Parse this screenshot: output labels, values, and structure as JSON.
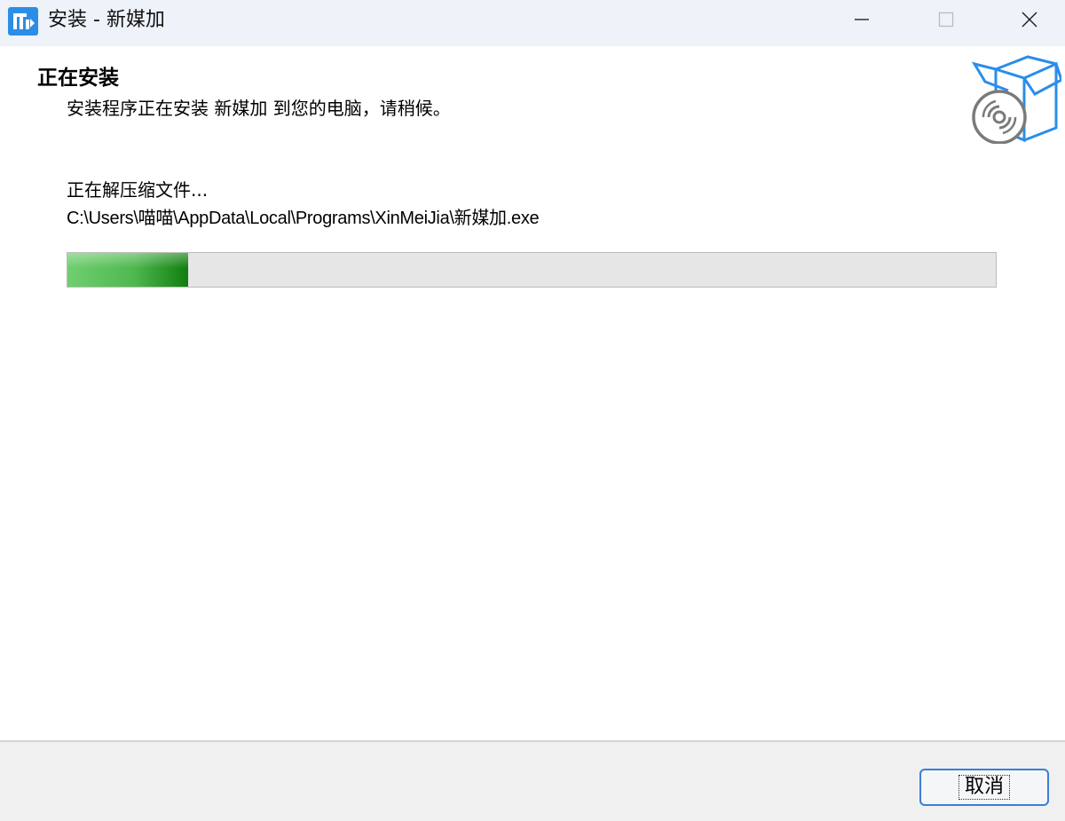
{
  "window": {
    "title": "安装 - 新媒加",
    "controls": [
      "minimize-icon",
      "maximize-icon",
      "close-icon"
    ]
  },
  "header": {
    "title": "正在安装",
    "subtitle": "安装程序正在安装 新媒加 到您的电脑，请稍候。",
    "icon": "install-box-cd-icon"
  },
  "status": {
    "text": "正在解压缩文件...",
    "path": "C:\\Users\\喵喵\\AppData\\Local\\Programs\\XinMeiJia\\新媒加.exe"
  },
  "progress": {
    "fraction": 0.13
  },
  "footer": {
    "cancel_label": "取消"
  },
  "colors": {
    "accent": "#2b8de8",
    "progress": "#0f7f0f",
    "button_border": "#3a7fd5"
  }
}
